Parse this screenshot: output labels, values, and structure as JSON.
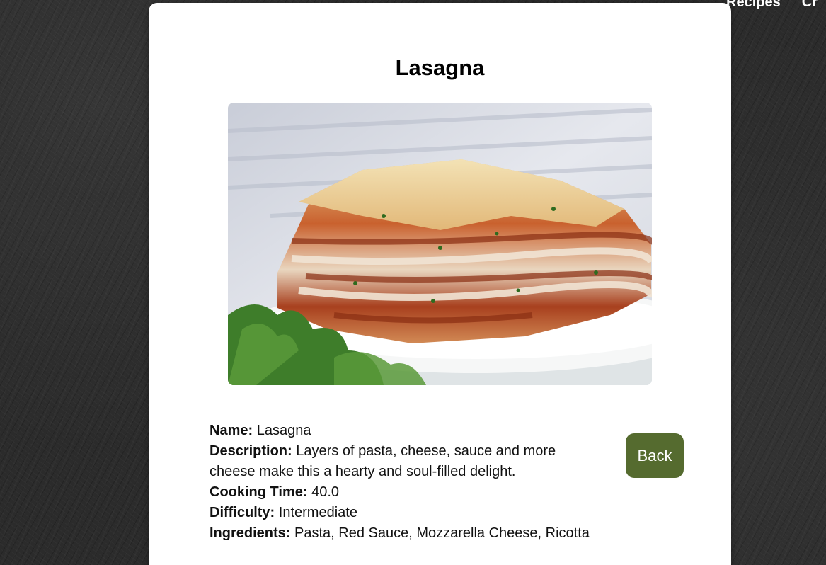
{
  "nav": {
    "items": [
      "Recipes",
      "Cr"
    ]
  },
  "recipe": {
    "title": "Lasagna",
    "image_alt": "Lasagna",
    "fields": {
      "name_label": "Name:",
      "name": "Lasagna",
      "description_label": "Description:",
      "description": "Layers of pasta, cheese, sauce and more cheese make this a hearty and soul-filled delight.",
      "cooking_time_label": "Cooking Time:",
      "cooking_time": "40.0",
      "difficulty_label": "Difficulty:",
      "difficulty": "Intermediate",
      "ingredients_label": "Ingredients:",
      "ingredients": "Pasta, Red Sauce, Mozzarella Cheese, Ricotta"
    },
    "back_label": "Back"
  },
  "colors": {
    "background": "#2b2b2b",
    "card": "#ffffff",
    "button": "#556b2f",
    "button_text": "#ffffff"
  }
}
